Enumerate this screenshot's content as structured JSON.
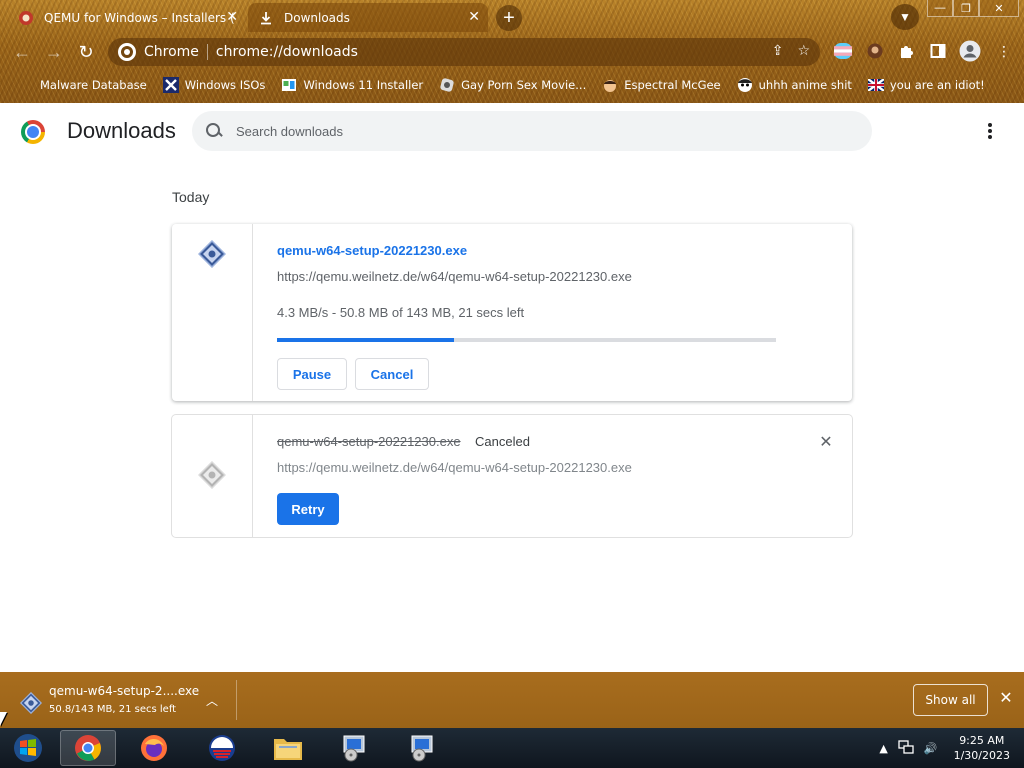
{
  "tabs": [
    {
      "title": "QEMU for Windows – Installers (",
      "close": "✕"
    },
    {
      "title": "Downloads",
      "close": "✕"
    }
  ],
  "window_controls": {
    "minimize": "—",
    "maximize": "❐",
    "close": "✕"
  },
  "omnibox": {
    "site_label": "Chrome",
    "url": "chrome://downloads"
  },
  "bookmarks": [
    {
      "label": "Malware Database"
    },
    {
      "label": "Windows ISOs"
    },
    {
      "label": "Windows 11 Installer"
    },
    {
      "label": "Gay Porn Sex Movie..."
    },
    {
      "label": "Espectral McGee"
    },
    {
      "label": "uhhh anime shit"
    },
    {
      "label": "you are an idiot!"
    }
  ],
  "page": {
    "title": "Downloads",
    "search_placeholder": "Search downloads",
    "section_label": "Today"
  },
  "downloads": [
    {
      "filename": "qemu-w64-setup-20221230.exe",
      "url": "https://qemu.weilnetz.de/w64/qemu-w64-setup-20221230.exe",
      "progress_text": "4.3 MB/s - 50.8 MB of 143 MB, 21 secs left",
      "progress_fraction": 0.355,
      "pause_label": "Pause",
      "cancel_label": "Cancel"
    },
    {
      "filename": "qemu-w64-setup-20221230.exe",
      "status": "Canceled",
      "url": "https://qemu.weilnetz.de/w64/qemu-w64-setup-20221230.exe",
      "retry_label": "Retry",
      "remove_label": "✕"
    }
  ],
  "shelf": {
    "filename": "qemu-w64-setup-2....exe",
    "status": "50.8/143 MB, 21 secs left",
    "show_all_label": "Show all",
    "close": "✕"
  },
  "taskbar": {
    "time": "9:25 AM",
    "date": "1/30/2023"
  },
  "colors": {
    "accent": "#1a73e8",
    "frame_theme": "#9a6419",
    "taskbar": "#0f161e"
  }
}
